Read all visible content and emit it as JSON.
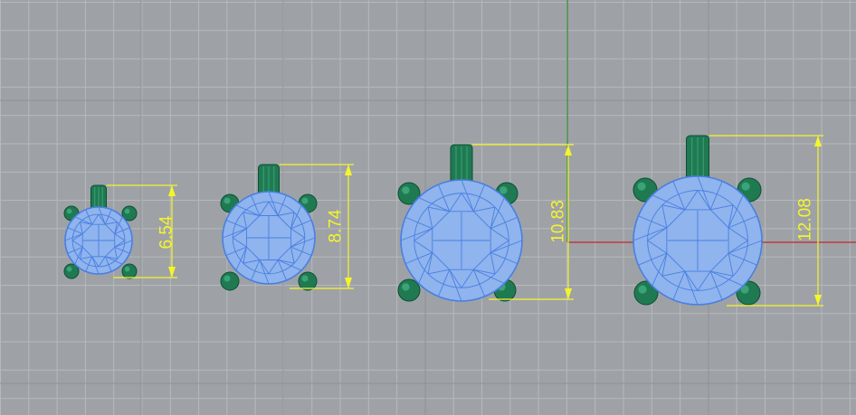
{
  "viewport": {
    "colors": {
      "background": "#9ea2a6",
      "grid_minor": "#b6b9bc",
      "grid_major": "#8d9195",
      "axis_x": "#c0292a",
      "axis_y": "#3e8a3a",
      "gem_fill": "#8fb4ee",
      "gem_wire": "#4a7fe0",
      "metal": "#1f7a52",
      "dimension": "#f5f52a"
    }
  },
  "pendants": [
    {
      "id": "pendant-1",
      "dimension_label": "6.54"
    },
    {
      "id": "pendant-2",
      "dimension_label": "8.74"
    },
    {
      "id": "pendant-3",
      "dimension_label": "10.83"
    },
    {
      "id": "pendant-4",
      "dimension_label": "12.08"
    }
  ]
}
